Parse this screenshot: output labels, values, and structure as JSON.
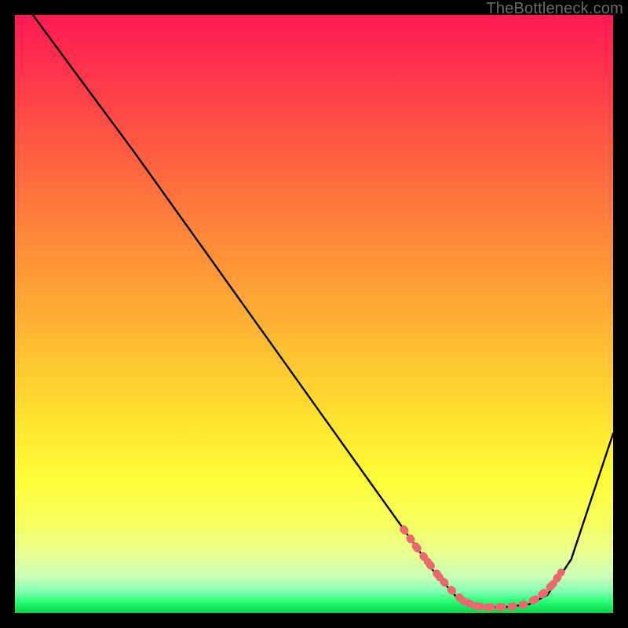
{
  "watermark": "TheBottleneck.com",
  "chart_data": {
    "type": "line",
    "title": "",
    "xlabel": "",
    "ylabel": "",
    "xlim": [
      0,
      100
    ],
    "ylim": [
      0,
      100
    ],
    "series": [
      {
        "name": "curve",
        "x": [
          3,
          10,
          20,
          30,
          40,
          50,
          60,
          65,
          70,
          74,
          78,
          82,
          86,
          89,
          93,
          100
        ],
        "values": [
          100,
          90.5,
          77,
          63,
          49,
          35,
          21,
          14,
          7,
          2.5,
          1,
          1,
          1.5,
          3,
          9,
          30
        ]
      }
    ],
    "markers": {
      "name": "optimum-band",
      "style": "dots",
      "color": "#e86a6f",
      "x": [
        65,
        67,
        69,
        71,
        73,
        75,
        77,
        79,
        81,
        83,
        85,
        87,
        88.5,
        90,
        91.3
      ],
      "values": [
        14,
        11.2,
        8.6,
        6,
        3.8,
        2,
        1.2,
        1,
        1,
        1.1,
        1.4,
        2.3,
        3.4,
        4.9,
        6.8
      ]
    }
  }
}
